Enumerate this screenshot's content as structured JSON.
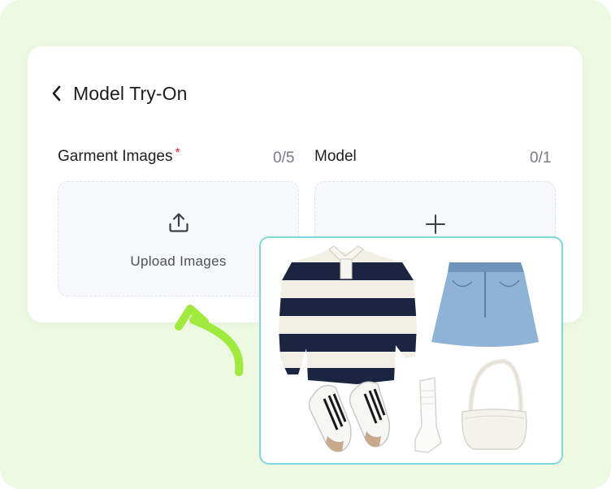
{
  "header": {
    "title": "Model Try-On"
  },
  "garments": {
    "label": "Garment Images",
    "required_mark": "*",
    "count": "0/5",
    "upload_label": "Upload Images"
  },
  "model": {
    "label": "Model",
    "count": "0/1"
  },
  "outfit": {
    "items": [
      "striped rugby sweater",
      "denim mini skirt",
      "sneakers",
      "white socks",
      "white shoulder bag"
    ]
  },
  "colors": {
    "background": "#eef9e2",
    "accent_green": "#9fea3c",
    "outfit_border": "#7ed8df",
    "required": "#e0262b"
  }
}
